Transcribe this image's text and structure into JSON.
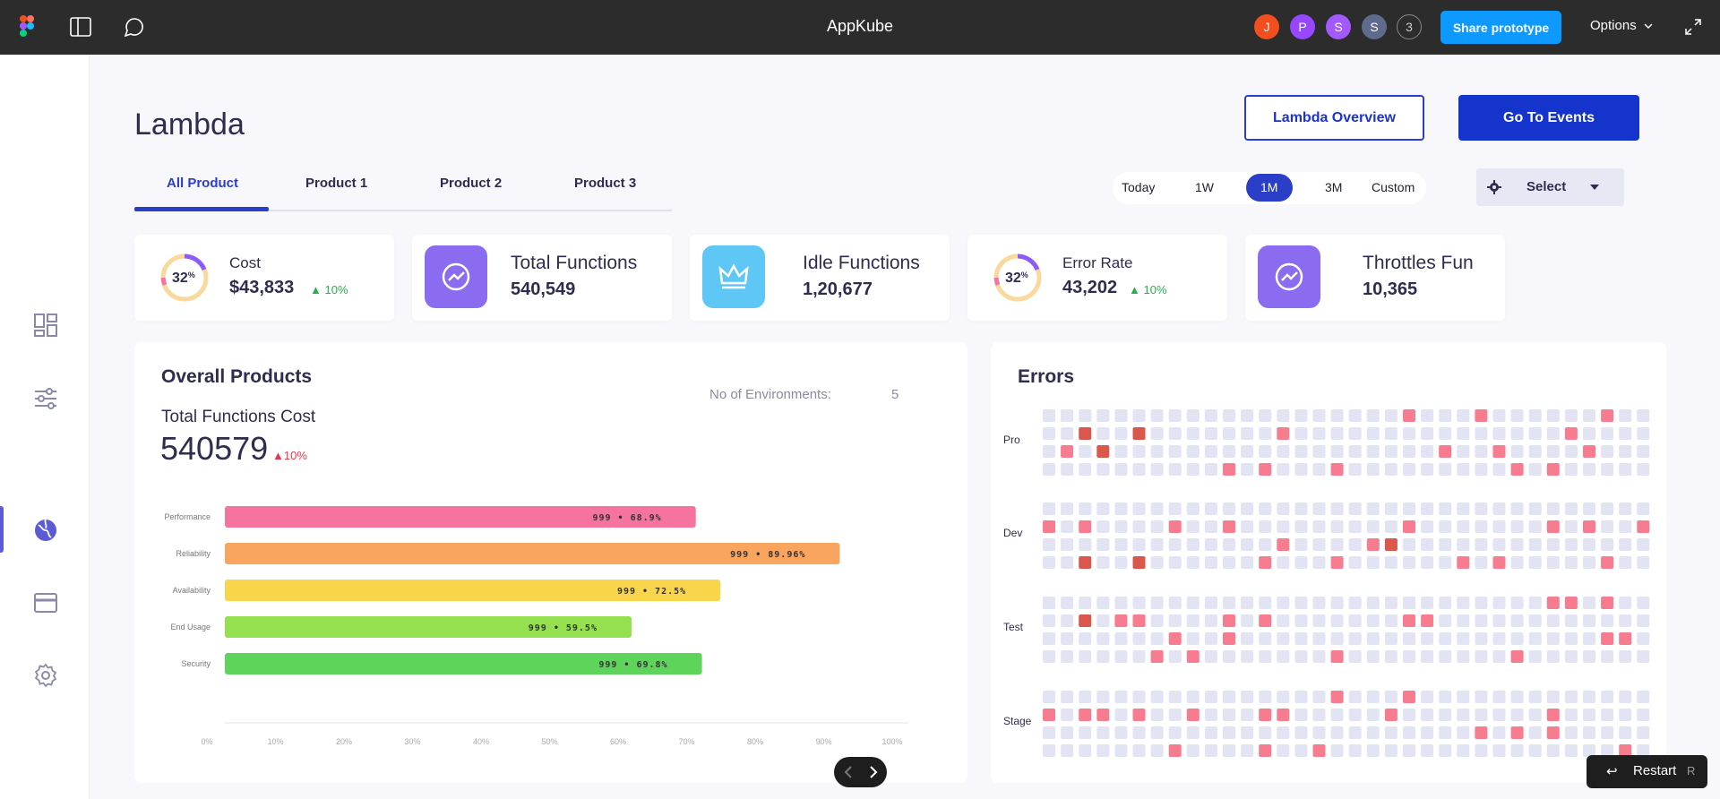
{
  "figma_bar": {
    "title": "AppKube",
    "avatars": [
      {
        "letter": "J",
        "color": "#f24e1e"
      },
      {
        "letter": "P",
        "color": "#9747ff"
      },
      {
        "letter": "S",
        "color": "#a259ff"
      },
      {
        "letter": "S",
        "color": "#5f6b8c"
      }
    ],
    "extra_count": "3",
    "share_label": "Share prototype",
    "options_label": "Options"
  },
  "page": {
    "title": "Lambda",
    "overview_button": "Lambda Overview",
    "events_button": "Go To Events",
    "tabs": [
      "All Product",
      "Product 1",
      "Product 2",
      "Product 3"
    ],
    "active_tab": "All Product",
    "ranges": [
      "Today",
      "1W",
      "1M",
      "3M",
      "Custom"
    ],
    "active_range": "1M",
    "select_label": "Select"
  },
  "kpis": [
    {
      "label": "Cost",
      "value": "$43,833",
      "ring": "32",
      "ring_unit": "%",
      "delta": "10%"
    },
    {
      "label": "Total Functions",
      "value": "540,549",
      "icon": "chart-trend-icon"
    },
    {
      "label": "Idle Functions",
      "value": "1,20,677",
      "icon": "crown-icon"
    },
    {
      "label": "Error Rate",
      "value": "43,202",
      "ring": "32",
      "ring_unit": "%",
      "delta": "10%"
    },
    {
      "label": "Throttles Fun",
      "value": "10,365",
      "icon": "chart-trend-icon"
    }
  ],
  "overall": {
    "title": "Overall Products",
    "env_label": "No of Environments:",
    "env_value": "5",
    "cost_label": "Total Functions Cost",
    "cost_value": "540579",
    "cost_delta": "10%"
  },
  "chart_data": {
    "type": "bar",
    "orientation": "horizontal",
    "categories": [
      "Performance",
      "Reliability",
      "Availability",
      "End Usage",
      "Security"
    ],
    "values": [
      68.9,
      89.96,
      72.5,
      59.5,
      69.8
    ],
    "value_labels": [
      "999 • 68.9%",
      "999 • 89.96%",
      "999 • 72.5%",
      "999 • 59.5%",
      "999 • 69.8%"
    ],
    "colors": [
      "#f7739f",
      "#f9a45f",
      "#f8d54b",
      "#94e04f",
      "#5fd45a"
    ],
    "xticks": [
      "0%",
      "10%",
      "20%",
      "30%",
      "40%",
      "50%",
      "60%",
      "70%",
      "80%",
      "90%",
      "100%"
    ],
    "xlim": [
      0,
      100
    ]
  },
  "errors": {
    "title": "Errors",
    "rows": [
      "Pro",
      "Dev",
      "Test",
      "Stage"
    ],
    "cell_color": "#e3e4f3",
    "error_color": "#f77c90",
    "severe_color": "#d9574d",
    "columns": 34,
    "grid": [
      "0000000000000000000010001000000100",
      "0020020000000100000000000000010000",
      "0102000000000000000000100100001000",
      "0000000000101000100000000010100000",
      "0000000000000000000000000000000000",
      "1010000100100000000010000000101001",
      "0000000000000100001200000000000000",
      "0020020000001000100000010100000100",
      "0000000000000000000000000000110100",
      "0020110000101000000011000000000000",
      "0000000100100000000000000000000110",
      "0000001010000000100000000010000000",
      "0000000000000000100010000000000000",
      "1011010010001100000100000000100000",
      "0000000000000000000000001010100000",
      "0000000100001001000000000000000010"
    ]
  },
  "controls": {
    "restart_label": "Restart",
    "restart_shortcut": "R"
  }
}
